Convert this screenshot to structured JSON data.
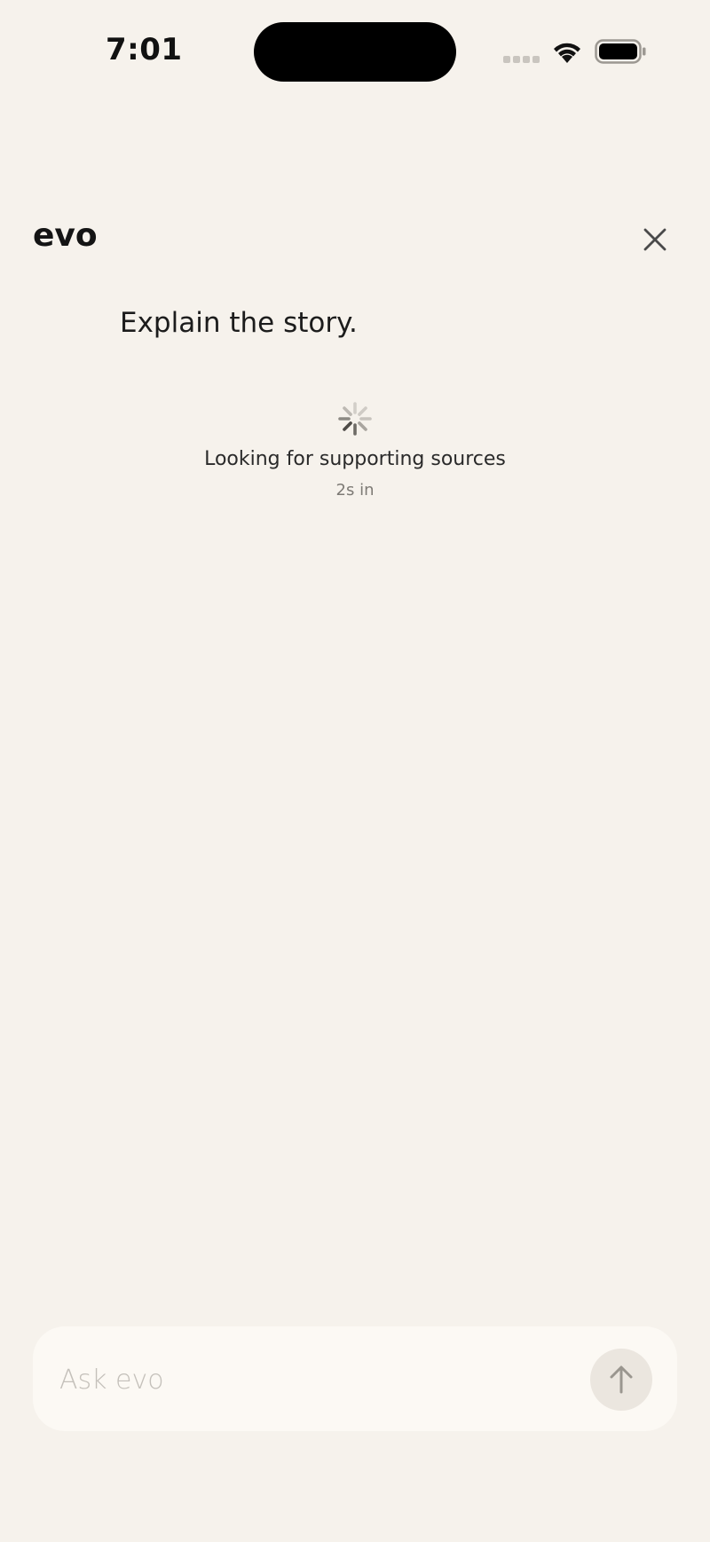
{
  "status_bar": {
    "time": "7:01"
  },
  "header": {
    "app_title": "evo",
    "close_icon": "close-icon"
  },
  "conversation": {
    "user_message": "Explain the story.",
    "status": {
      "title": "Looking for supporting sources",
      "elapsed": "2s in",
      "icon": "spinner-icon"
    }
  },
  "composer": {
    "placeholder": "Ask evo",
    "value": "",
    "send_icon": "arrow-up-icon"
  },
  "colors": {
    "background": "#f6f2ec",
    "composer": "#fcf9f4",
    "send_button": "#ebe6df",
    "text_primary": "#141414",
    "text_muted": "#7d7a75"
  }
}
